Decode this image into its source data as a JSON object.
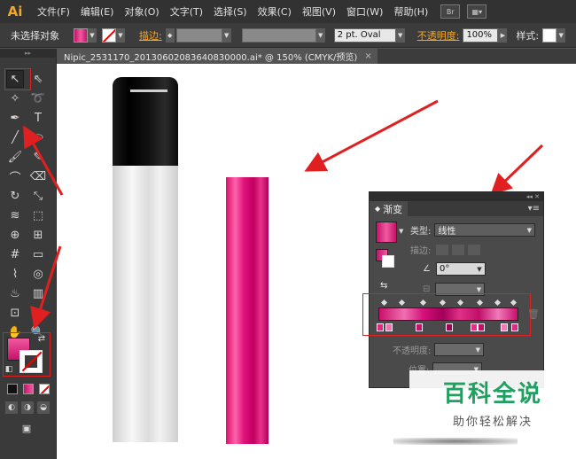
{
  "app": {
    "logo": "Ai"
  },
  "menu": {
    "items": [
      "文件(F)",
      "编辑(E)",
      "对象(O)",
      "文字(T)",
      "选择(S)",
      "效果(C)",
      "视图(V)",
      "窗口(W)",
      "帮助(H)"
    ],
    "bridge_icon": "Br"
  },
  "control_bar": {
    "selection_status": "未选择对象",
    "stroke_label": "描边:",
    "brush_value": "2 pt. Oval",
    "opacity_label": "不透明度:",
    "opacity_value": "100%",
    "style_label": "样式:"
  },
  "document_tab": {
    "title": "Nipic_2531170_20130602083640830000.ai* @ 150% (CMYK/预览)",
    "close": "×"
  },
  "gradient_panel": {
    "tab_label": "渐变",
    "type_label": "类型:",
    "type_value": "线性",
    "stroke_label": "描边:",
    "angle_value": "0°",
    "opacity_label": "不透明度:",
    "location_label": "位置:"
  },
  "watermark": {
    "title": "百科全说",
    "subtitle": "助你轻松解决"
  },
  "colors": {
    "accent_orange": "#f5a623",
    "gradient_pink": "#e0137a",
    "annotation_red": "#e02020"
  }
}
